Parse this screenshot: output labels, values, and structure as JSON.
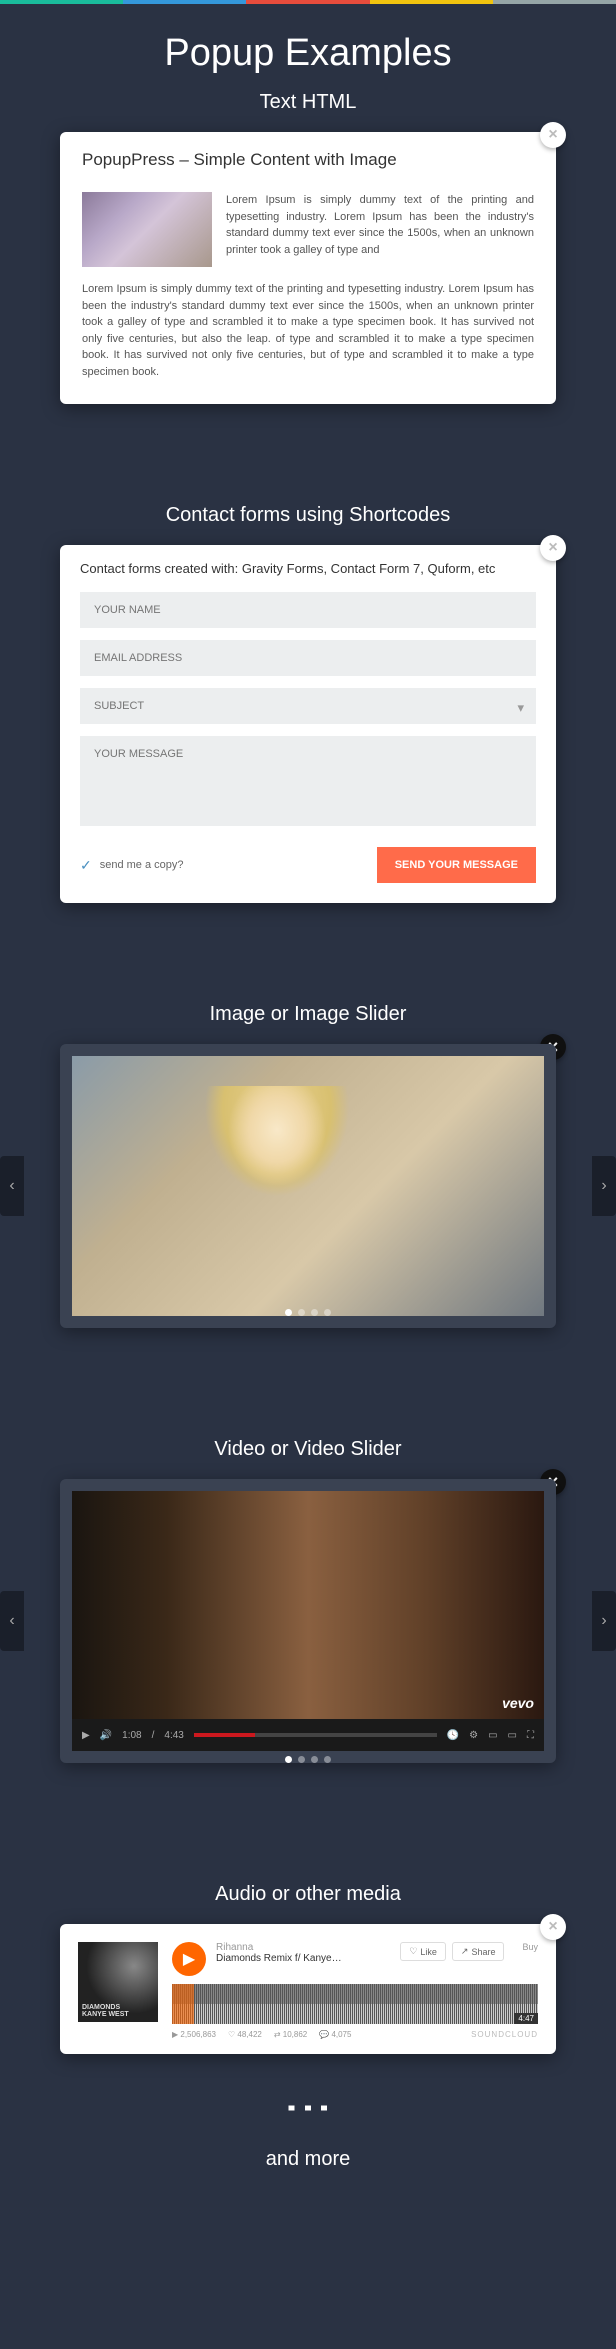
{
  "page_title": "Popup Examples",
  "sections": {
    "text": {
      "title": "Text HTML",
      "popup_title": "PopupPress – Simple Content with Image",
      "intro": "Lorem Ipsum is simply dummy text of the printing and typesetting industry. Lorem Ipsum has been the industry's standard dummy text ever since the 1500s, when an unknown printer took a galley of type and",
      "body": "Lorem Ipsum is simply dummy text of the printing and typesetting industry. Lorem Ipsum has been the industry's standard dummy text ever since the 1500s, when an unknown printer took a galley of type and scrambled it to make a type specimen book. It has survived not only five centuries, but also the leap. of type and scrambled it to make a type specimen book. It has survived not only five centuries, but of type and scrambled it to make a type specimen book."
    },
    "contact": {
      "title": "Contact forms using Shortcodes",
      "subtitle": "Contact forms created with: Gravity Forms, Contact Form 7, Quform, etc",
      "name_placeholder": "YOUR NAME",
      "email_placeholder": "EMAIL ADDRESS",
      "subject_placeholder": "SUBJECT",
      "message_placeholder": "YOUR MESSAGE",
      "copy_label": "send me a copy?",
      "send_label": "SEND YOUR MESSAGE"
    },
    "image": {
      "title": "Image or Image Slider"
    },
    "video": {
      "title": "Video or Video Slider",
      "brand": "vevo",
      "time_current": "1:08",
      "time_total": "4:43"
    },
    "audio": {
      "title": "Audio or other media",
      "album_line1": "DIAMONDS",
      "album_line2": "KANYE WEST",
      "artist": "Rihanna",
      "track": "Diamonds Remix f/ Kanye…",
      "like": "Like",
      "share": "Share",
      "buy": "Buy",
      "duration": "4:47",
      "stats": {
        "plays": "2,506,863",
        "likes": "48,422",
        "reposts": "10,862",
        "comments": "4,075"
      },
      "brand": "SOUNDCLOUD"
    }
  },
  "footer": "and more"
}
